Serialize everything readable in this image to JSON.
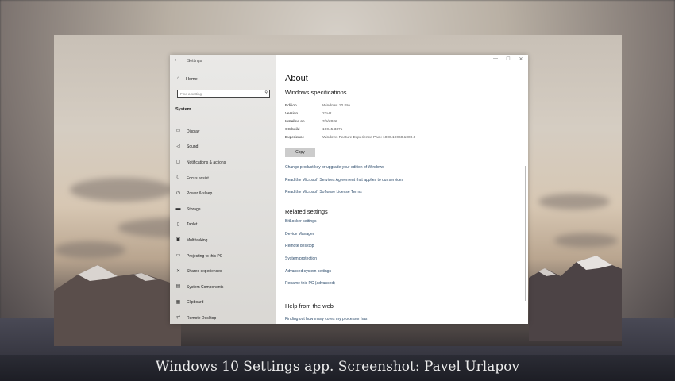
{
  "caption": "Windows 10 Settings app. Screenshot: Pavel Urlapov",
  "window": {
    "title": "Settings",
    "controls": [
      "—",
      "☐",
      "✕"
    ]
  },
  "sidebar": {
    "home_label": "Home",
    "search_placeholder": "Find a setting",
    "section_label": "System",
    "items": [
      {
        "label": "Display",
        "icon": "display-icon",
        "glyph": "▭"
      },
      {
        "label": "Sound",
        "icon": "sound-icon",
        "glyph": "◁"
      },
      {
        "label": "Notifications & actions",
        "icon": "notifications-icon",
        "glyph": "▢"
      },
      {
        "label": "Focus assist",
        "icon": "focus-assist-icon",
        "glyph": "☾"
      },
      {
        "label": "Power & sleep",
        "icon": "power-icon",
        "glyph": "⏻"
      },
      {
        "label": "Storage",
        "icon": "storage-icon",
        "glyph": "▬"
      },
      {
        "label": "Tablet",
        "icon": "tablet-icon",
        "glyph": "▯"
      },
      {
        "label": "Multitasking",
        "icon": "multitasking-icon",
        "glyph": "▣"
      },
      {
        "label": "Projecting to this PC",
        "icon": "projecting-icon",
        "glyph": "▭"
      },
      {
        "label": "Shared experiences",
        "icon": "shared-experiences-icon",
        "glyph": "✕"
      },
      {
        "label": "System Components",
        "icon": "system-components-icon",
        "glyph": "▤"
      },
      {
        "label": "Clipboard",
        "icon": "clipboard-icon",
        "glyph": "▦"
      },
      {
        "label": "Remote Desktop",
        "icon": "remote-desktop-icon",
        "glyph": "⇄"
      }
    ]
  },
  "content": {
    "title": "About",
    "specs_heading": "Windows specifications",
    "specs": [
      {
        "key": "Edition",
        "value": "Windows 10 Pro"
      },
      {
        "key": "Version",
        "value": "22H2"
      },
      {
        "key": "Installed on",
        "value": "7/5/2022"
      },
      {
        "key": "OS build",
        "value": "19045.3371"
      },
      {
        "key": "Experience",
        "value": "Windows Feature Experience Pack 1000.19060.1000.0"
      }
    ],
    "copy_label": "Copy",
    "links": [
      "Change product key or upgrade your edition of Windows",
      "Read the Microsoft Services Agreement that applies to our services",
      "Read the Microsoft Software License Terms"
    ],
    "related_heading": "Related settings",
    "related_links": [
      "BitLocker settings",
      "Device Manager",
      "Remote desktop",
      "System protection",
      "Advanced system settings",
      "Rename this PC (advanced)"
    ],
    "help_heading": "Help from the web",
    "help_links": [
      "Finding out how many cores my processor has"
    ]
  }
}
